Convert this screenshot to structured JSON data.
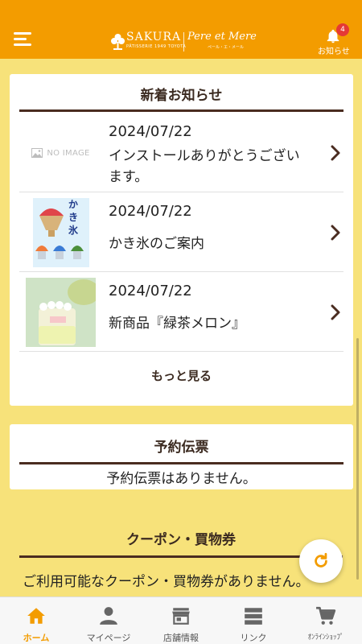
{
  "header": {
    "brand_main": "SAKURA",
    "brand_sub": "PÂTISSERIE 1949 TOYOTA",
    "brand_secondary": "Pere et Mere",
    "brand_secondary_sub": "ペール・エ・メール",
    "notification_label": "お知らせ",
    "notification_count": "4",
    "accent_color": "#f39c00"
  },
  "news": {
    "title": "新着お知らせ",
    "items": [
      {
        "date": "2024/07/22",
        "text": "インストールありがとうございます。",
        "thumb": "NO IMAGE"
      },
      {
        "date": "2024/07/22",
        "text": "かき氷のご案内",
        "thumb": "kakigori-image"
      },
      {
        "date": "2024/07/22",
        "text": "新商品『緑茶メロン』",
        "thumb": "melon-dessert-image"
      }
    ],
    "more_label": "もっと見る"
  },
  "reservation": {
    "title": "予約伝票",
    "empty_text": "予約伝票はありません。"
  },
  "coupon": {
    "title": "クーポン・買物券",
    "empty_text": "ご利用可能なクーポン・買物券がありません。"
  },
  "bottom_nav": [
    {
      "label": "ホーム",
      "icon": "home-icon",
      "active": true
    },
    {
      "label": "マイページ",
      "icon": "person-icon",
      "active": false
    },
    {
      "label": "店舗情報",
      "icon": "store-icon",
      "active": false
    },
    {
      "label": "リンク",
      "icon": "list-icon",
      "active": false
    },
    {
      "label": "ｵﾝﾗｲﾝｼｮｯﾌﾟ",
      "icon": "cart-icon",
      "active": false
    }
  ]
}
